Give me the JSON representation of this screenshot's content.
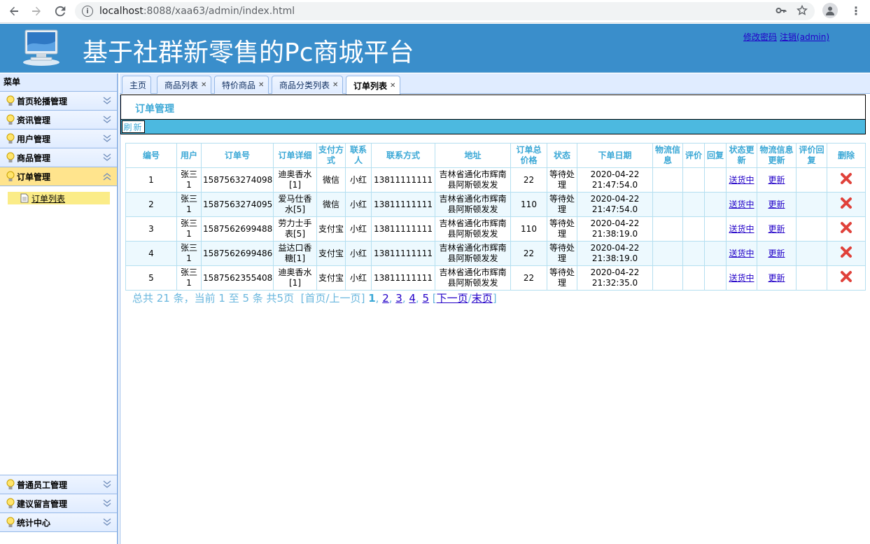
{
  "browser": {
    "url_host": "localhost",
    "url_rest": ":8088/xaa63/admin/index.html"
  },
  "header": {
    "title": "基于社群新零售的Pc商城平台",
    "change_password": "修改密码",
    "logout": "注销(admin)"
  },
  "sidebar": {
    "title": "菜单",
    "top_items": [
      {
        "label": "首页轮播管理"
      },
      {
        "label": "资讯管理"
      },
      {
        "label": "用户管理"
      },
      {
        "label": "商品管理"
      },
      {
        "label": "订单管理"
      }
    ],
    "sub_item": "订单列表",
    "bottom_items": [
      {
        "label": "普通员工管理"
      },
      {
        "label": "建议留言管理"
      },
      {
        "label": "统计中心"
      }
    ]
  },
  "tabs": [
    {
      "label": "主页",
      "closable": false
    },
    {
      "label": "商品列表",
      "closable": true
    },
    {
      "label": "特价商品",
      "closable": true
    },
    {
      "label": "商品分类列表",
      "closable": true
    },
    {
      "label": "订单列表",
      "closable": true,
      "active": true
    }
  ],
  "panel": {
    "title": "订单管理",
    "refresh": "刷新"
  },
  "table": {
    "headers": [
      "编号",
      "用户",
      "订单号",
      "订单详细",
      "支付方式",
      "联系人",
      "联系方式",
      "地址",
      "订单总价格",
      "状态",
      "下单日期",
      "物流信息",
      "评价",
      "回复",
      "状态更新",
      "物流信息更新",
      "评价回复",
      "删除"
    ],
    "rows": [
      {
        "id": "1",
        "user": "张三1",
        "order_no": "1587563274098",
        "detail": "迪奥香水[1]",
        "pay": "微信",
        "contact": "小红",
        "phone": "13811111111",
        "address": "吉林省通化市辉南县阿斯顿发发",
        "total": "22",
        "status": "等待处理",
        "date": "2020-04-22 21:47:54.0",
        "logistics": "",
        "review": "",
        "reply": "",
        "status_update": "送货中",
        "logistics_update": "更新",
        "review_reply": ""
      },
      {
        "id": "2",
        "user": "张三1",
        "order_no": "1587563274095",
        "detail": "爱马仕香水[5]",
        "pay": "微信",
        "contact": "小红",
        "phone": "13811111111",
        "address": "吉林省通化市辉南县阿斯顿发发",
        "total": "110",
        "status": "等待处理",
        "date": "2020-04-22 21:47:54.0",
        "logistics": "",
        "review": "",
        "reply": "",
        "status_update": "送货中",
        "logistics_update": "更新",
        "review_reply": ""
      },
      {
        "id": "3",
        "user": "张三1",
        "order_no": "1587562699488",
        "detail": "劳力士手表[5]",
        "pay": "支付宝",
        "contact": "小红",
        "phone": "13811111111",
        "address": "吉林省通化市辉南县阿斯顿发发",
        "total": "110",
        "status": "等待处理",
        "date": "2020-04-22 21:38:19.0",
        "logistics": "",
        "review": "",
        "reply": "",
        "status_update": "送货中",
        "logistics_update": "更新",
        "review_reply": ""
      },
      {
        "id": "4",
        "user": "张三1",
        "order_no": "1587562699486",
        "detail": "益达口香糖[1]",
        "pay": "支付宝",
        "contact": "小红",
        "phone": "13811111111",
        "address": "吉林省通化市辉南县阿斯顿发发",
        "total": "22",
        "status": "等待处理",
        "date": "2020-04-22 21:38:19.0",
        "logistics": "",
        "review": "",
        "reply": "",
        "status_update": "送货中",
        "logistics_update": "更新",
        "review_reply": ""
      },
      {
        "id": "5",
        "user": "张三1",
        "order_no": "1587562355408",
        "detail": "迪奥香水[1]",
        "pay": "支付宝",
        "contact": "小红",
        "phone": "13811111111",
        "address": "吉林省通化市辉南县阿斯顿发发",
        "total": "22",
        "status": "等待处理",
        "date": "2020-04-22 21:32:35.0",
        "logistics": "",
        "review": "",
        "reply": "",
        "status_update": "送货中",
        "logistics_update": "更新",
        "review_reply": ""
      }
    ]
  },
  "pager": {
    "summary": "总共 21 条，当前 1 至 5 条 共5页",
    "first_prev": "[首页/上一页]",
    "current": "1",
    "pages": [
      "2",
      "3",
      "4",
      "5"
    ],
    "next": "下一页",
    "last": "末页"
  },
  "colors": {
    "header_bg": "#3a8ecb",
    "accent_text": "#3ba8d6",
    "toolbar_bg": "#4cb9e0",
    "active_menu": "#ffe48d",
    "delete_red": "#e0413a"
  }
}
